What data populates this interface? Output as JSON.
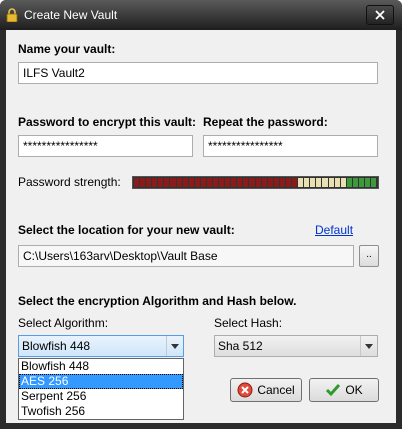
{
  "window": {
    "title": "Create New Vault"
  },
  "name": {
    "label": "Name your vault:",
    "value": "ILFS Vault2"
  },
  "password": {
    "label": "Password to encrypt this vault:",
    "value": "****************",
    "repeat_label": "Repeat the password:",
    "repeat_value": "****************",
    "strength_label": "Password strength:",
    "strength_level": 0.68
  },
  "location": {
    "label": "Select the location for your new vault:",
    "default_link": "Default",
    "path": "C:\\Users\\163arv\\Desktop\\Vault Base",
    "browse_label": ".."
  },
  "encryption": {
    "heading": "Select the encryption Algorithm and Hash below.",
    "algorithm_label": "Select Algorithm:",
    "algorithm_value": "Blowfish 448",
    "algorithm_options": [
      "Blowfish 448",
      "AES 256",
      "Serpent 256",
      "Twofish 256"
    ],
    "highlighted_option": "AES 256",
    "hash_label": "Select Hash:",
    "hash_value": "Sha 512"
  },
  "buttons": {
    "cancel": "Cancel",
    "ok": "OK"
  },
  "colors": {
    "strength_weak": "#8b1a1a",
    "strength_medium": "#e8e0b0",
    "strength_strong": "#3c9a3c",
    "selection": "#3399ff",
    "link": "#0033cc"
  }
}
